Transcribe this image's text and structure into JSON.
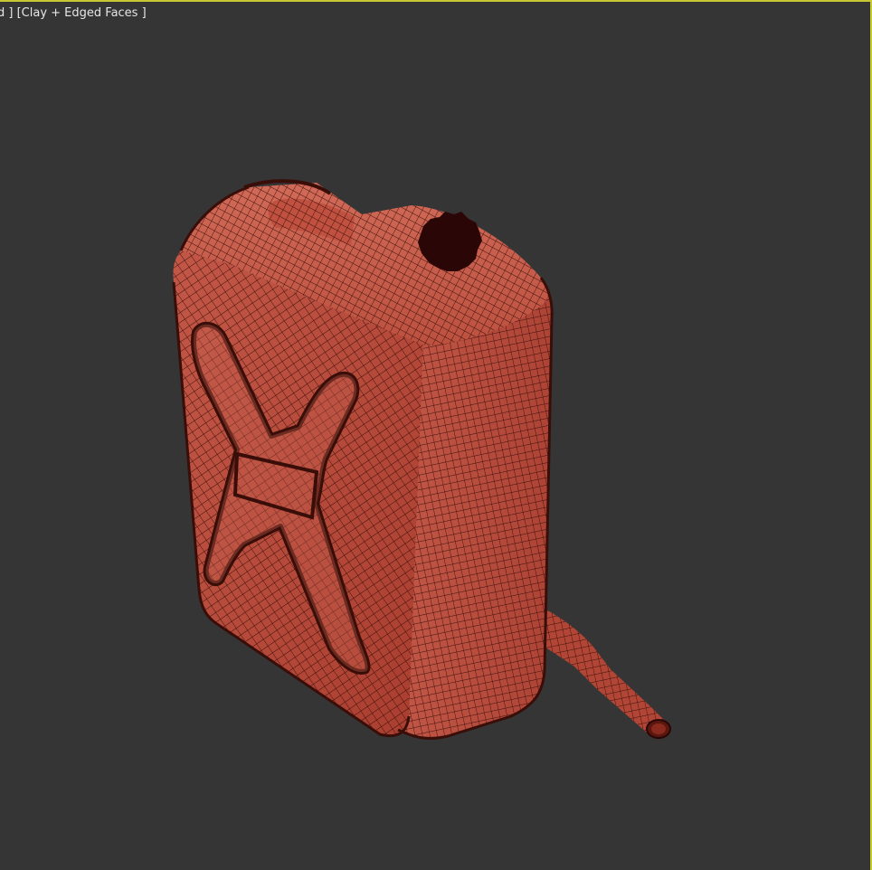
{
  "viewport": {
    "label_prefix": "d ]",
    "shading_mode": "[Clay + Edged Faces ]",
    "background_color": "#353535",
    "active_border_color": "#c8c832"
  },
  "model": {
    "object": "jerrycan",
    "body_color": "#b84a3a",
    "wire_color": "#3a0e08",
    "cap_color": "#2a0606",
    "display": "clay + edged faces"
  }
}
